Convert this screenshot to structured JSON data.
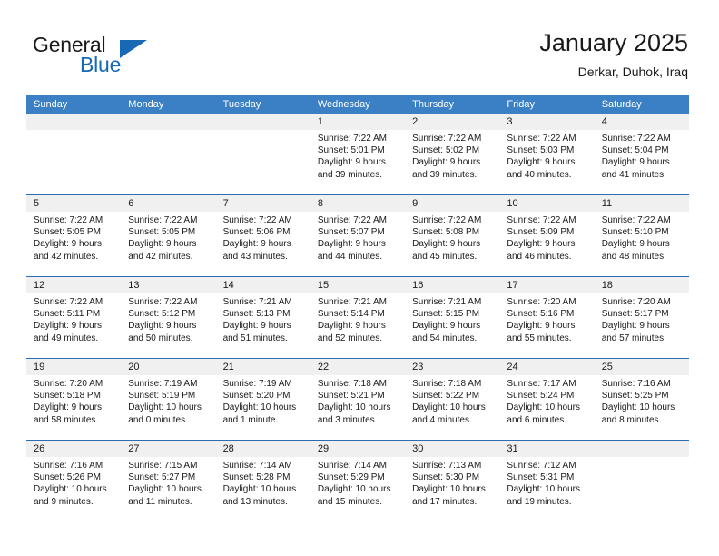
{
  "brand": {
    "name_part1": "General",
    "name_part2": "Blue",
    "accent_color": "#1769b4"
  },
  "header": {
    "title": "January 2025",
    "subtitle": "Derkar, Duhok, Iraq",
    "header_bar_color": "#3b7fc4"
  },
  "weekdays": [
    "Sunday",
    "Monday",
    "Tuesday",
    "Wednesday",
    "Thursday",
    "Friday",
    "Saturday"
  ],
  "weeks": [
    [
      {
        "day": "",
        "sunrise": "",
        "sunset": "",
        "daylight_line1": "",
        "daylight_line2": "",
        "empty": true
      },
      {
        "day": "",
        "sunrise": "",
        "sunset": "",
        "daylight_line1": "",
        "daylight_line2": "",
        "empty": true
      },
      {
        "day": "",
        "sunrise": "",
        "sunset": "",
        "daylight_line1": "",
        "daylight_line2": "",
        "empty": true
      },
      {
        "day": "1",
        "sunrise": "Sunrise: 7:22 AM",
        "sunset": "Sunset: 5:01 PM",
        "daylight_line1": "Daylight: 9 hours",
        "daylight_line2": "and 39 minutes.",
        "empty": false
      },
      {
        "day": "2",
        "sunrise": "Sunrise: 7:22 AM",
        "sunset": "Sunset: 5:02 PM",
        "daylight_line1": "Daylight: 9 hours",
        "daylight_line2": "and 39 minutes.",
        "empty": false
      },
      {
        "day": "3",
        "sunrise": "Sunrise: 7:22 AM",
        "sunset": "Sunset: 5:03 PM",
        "daylight_line1": "Daylight: 9 hours",
        "daylight_line2": "and 40 minutes.",
        "empty": false
      },
      {
        "day": "4",
        "sunrise": "Sunrise: 7:22 AM",
        "sunset": "Sunset: 5:04 PM",
        "daylight_line1": "Daylight: 9 hours",
        "daylight_line2": "and 41 minutes.",
        "empty": false
      }
    ],
    [
      {
        "day": "5",
        "sunrise": "Sunrise: 7:22 AM",
        "sunset": "Sunset: 5:05 PM",
        "daylight_line1": "Daylight: 9 hours",
        "daylight_line2": "and 42 minutes.",
        "empty": false
      },
      {
        "day": "6",
        "sunrise": "Sunrise: 7:22 AM",
        "sunset": "Sunset: 5:05 PM",
        "daylight_line1": "Daylight: 9 hours",
        "daylight_line2": "and 42 minutes.",
        "empty": false
      },
      {
        "day": "7",
        "sunrise": "Sunrise: 7:22 AM",
        "sunset": "Sunset: 5:06 PM",
        "daylight_line1": "Daylight: 9 hours",
        "daylight_line2": "and 43 minutes.",
        "empty": false
      },
      {
        "day": "8",
        "sunrise": "Sunrise: 7:22 AM",
        "sunset": "Sunset: 5:07 PM",
        "daylight_line1": "Daylight: 9 hours",
        "daylight_line2": "and 44 minutes.",
        "empty": false
      },
      {
        "day": "9",
        "sunrise": "Sunrise: 7:22 AM",
        "sunset": "Sunset: 5:08 PM",
        "daylight_line1": "Daylight: 9 hours",
        "daylight_line2": "and 45 minutes.",
        "empty": false
      },
      {
        "day": "10",
        "sunrise": "Sunrise: 7:22 AM",
        "sunset": "Sunset: 5:09 PM",
        "daylight_line1": "Daylight: 9 hours",
        "daylight_line2": "and 46 minutes.",
        "empty": false
      },
      {
        "day": "11",
        "sunrise": "Sunrise: 7:22 AM",
        "sunset": "Sunset: 5:10 PM",
        "daylight_line1": "Daylight: 9 hours",
        "daylight_line2": "and 48 minutes.",
        "empty": false
      }
    ],
    [
      {
        "day": "12",
        "sunrise": "Sunrise: 7:22 AM",
        "sunset": "Sunset: 5:11 PM",
        "daylight_line1": "Daylight: 9 hours",
        "daylight_line2": "and 49 minutes.",
        "empty": false
      },
      {
        "day": "13",
        "sunrise": "Sunrise: 7:22 AM",
        "sunset": "Sunset: 5:12 PM",
        "daylight_line1": "Daylight: 9 hours",
        "daylight_line2": "and 50 minutes.",
        "empty": false
      },
      {
        "day": "14",
        "sunrise": "Sunrise: 7:21 AM",
        "sunset": "Sunset: 5:13 PM",
        "daylight_line1": "Daylight: 9 hours",
        "daylight_line2": "and 51 minutes.",
        "empty": false
      },
      {
        "day": "15",
        "sunrise": "Sunrise: 7:21 AM",
        "sunset": "Sunset: 5:14 PM",
        "daylight_line1": "Daylight: 9 hours",
        "daylight_line2": "and 52 minutes.",
        "empty": false
      },
      {
        "day": "16",
        "sunrise": "Sunrise: 7:21 AM",
        "sunset": "Sunset: 5:15 PM",
        "daylight_line1": "Daylight: 9 hours",
        "daylight_line2": "and 54 minutes.",
        "empty": false
      },
      {
        "day": "17",
        "sunrise": "Sunrise: 7:20 AM",
        "sunset": "Sunset: 5:16 PM",
        "daylight_line1": "Daylight: 9 hours",
        "daylight_line2": "and 55 minutes.",
        "empty": false
      },
      {
        "day": "18",
        "sunrise": "Sunrise: 7:20 AM",
        "sunset": "Sunset: 5:17 PM",
        "daylight_line1": "Daylight: 9 hours",
        "daylight_line2": "and 57 minutes.",
        "empty": false
      }
    ],
    [
      {
        "day": "19",
        "sunrise": "Sunrise: 7:20 AM",
        "sunset": "Sunset: 5:18 PM",
        "daylight_line1": "Daylight: 9 hours",
        "daylight_line2": "and 58 minutes.",
        "empty": false
      },
      {
        "day": "20",
        "sunrise": "Sunrise: 7:19 AM",
        "sunset": "Sunset: 5:19 PM",
        "daylight_line1": "Daylight: 10 hours",
        "daylight_line2": "and 0 minutes.",
        "empty": false
      },
      {
        "day": "21",
        "sunrise": "Sunrise: 7:19 AM",
        "sunset": "Sunset: 5:20 PM",
        "daylight_line1": "Daylight: 10 hours",
        "daylight_line2": "and 1 minute.",
        "empty": false
      },
      {
        "day": "22",
        "sunrise": "Sunrise: 7:18 AM",
        "sunset": "Sunset: 5:21 PM",
        "daylight_line1": "Daylight: 10 hours",
        "daylight_line2": "and 3 minutes.",
        "empty": false
      },
      {
        "day": "23",
        "sunrise": "Sunrise: 7:18 AM",
        "sunset": "Sunset: 5:22 PM",
        "daylight_line1": "Daylight: 10 hours",
        "daylight_line2": "and 4 minutes.",
        "empty": false
      },
      {
        "day": "24",
        "sunrise": "Sunrise: 7:17 AM",
        "sunset": "Sunset: 5:24 PM",
        "daylight_line1": "Daylight: 10 hours",
        "daylight_line2": "and 6 minutes.",
        "empty": false
      },
      {
        "day": "25",
        "sunrise": "Sunrise: 7:16 AM",
        "sunset": "Sunset: 5:25 PM",
        "daylight_line1": "Daylight: 10 hours",
        "daylight_line2": "and 8 minutes.",
        "empty": false
      }
    ],
    [
      {
        "day": "26",
        "sunrise": "Sunrise: 7:16 AM",
        "sunset": "Sunset: 5:26 PM",
        "daylight_line1": "Daylight: 10 hours",
        "daylight_line2": "and 9 minutes.",
        "empty": false
      },
      {
        "day": "27",
        "sunrise": "Sunrise: 7:15 AM",
        "sunset": "Sunset: 5:27 PM",
        "daylight_line1": "Daylight: 10 hours",
        "daylight_line2": "and 11 minutes.",
        "empty": false
      },
      {
        "day": "28",
        "sunrise": "Sunrise: 7:14 AM",
        "sunset": "Sunset: 5:28 PM",
        "daylight_line1": "Daylight: 10 hours",
        "daylight_line2": "and 13 minutes.",
        "empty": false
      },
      {
        "day": "29",
        "sunrise": "Sunrise: 7:14 AM",
        "sunset": "Sunset: 5:29 PM",
        "daylight_line1": "Daylight: 10 hours",
        "daylight_line2": "and 15 minutes.",
        "empty": false
      },
      {
        "day": "30",
        "sunrise": "Sunrise: 7:13 AM",
        "sunset": "Sunset: 5:30 PM",
        "daylight_line1": "Daylight: 10 hours",
        "daylight_line2": "and 17 minutes.",
        "empty": false
      },
      {
        "day": "31",
        "sunrise": "Sunrise: 7:12 AM",
        "sunset": "Sunset: 5:31 PM",
        "daylight_line1": "Daylight: 10 hours",
        "daylight_line2": "and 19 minutes.",
        "empty": false
      },
      {
        "day": "",
        "sunrise": "",
        "sunset": "",
        "daylight_line1": "",
        "daylight_line2": "",
        "empty": true
      }
    ]
  ]
}
